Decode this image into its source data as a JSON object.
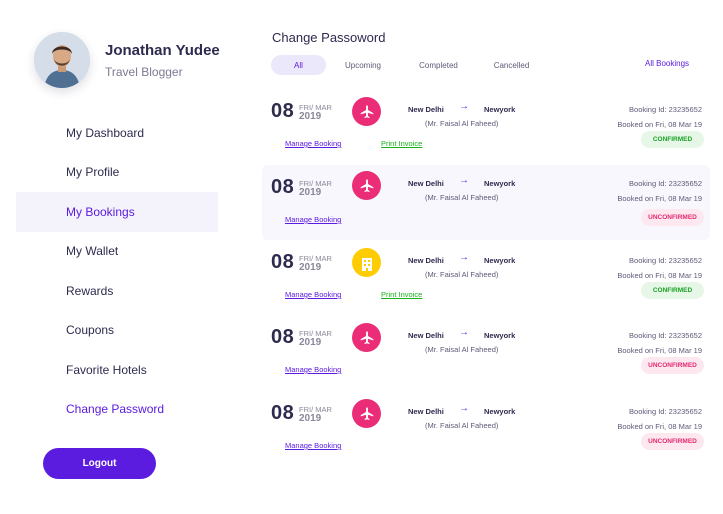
{
  "profile": {
    "name": "Jonathan Yudee",
    "role": "Travel Blogger"
  },
  "nav": [
    {
      "label": "My Dashboard",
      "active": false
    },
    {
      "label": "My Profile",
      "active": false
    },
    {
      "label": "My Bookings",
      "active": true
    },
    {
      "label": "My Wallet",
      "active": false
    },
    {
      "label": "Rewards",
      "active": false
    },
    {
      "label": "Coupons",
      "active": false
    },
    {
      "label": "Favorite Hotels",
      "active": false
    },
    {
      "label": "Change Password",
      "active": false,
      "accent": true
    }
  ],
  "logout_label": "Logout",
  "page_title": "Change Passoword",
  "tabs": [
    {
      "label": "All",
      "active": true
    },
    {
      "label": "Upcoming",
      "active": false
    },
    {
      "label": "Completed",
      "active": false
    },
    {
      "label": "Cancelled",
      "active": false
    }
  ],
  "all_bookings_label": "All Bookings",
  "colors": {
    "accent": "#5b1ce0",
    "flight_icon": "#ea2d76",
    "hotel_icon": "#ffcc02",
    "confirmed": "#1aa225",
    "unconfirmed": "#e4286f"
  },
  "bookings": [
    {
      "day": "08",
      "month": "FRI/ MAR",
      "year": "2019",
      "type_icon": "airplane-icon",
      "from": "New Delhi",
      "to": "Newyork",
      "passenger": "(Mr. Faisal Al Faheed)",
      "booking_id": "Booking Id: 23235652",
      "booked_on": "Booked on Fri, 08 Mar 19",
      "manage_label": "Manage Booking",
      "print_label": "Print Invoice",
      "status": "CONFIRMED",
      "status_type": "confirmed",
      "highlight": false
    },
    {
      "day": "08",
      "month": "FRI/ MAR",
      "year": "2019",
      "type_icon": "airplane-icon",
      "from": "New Delhi",
      "to": "Newyork",
      "passenger": "(Mr. Faisal Al Faheed)",
      "booking_id": "Booking Id: 23235652",
      "booked_on": "Booked on Fri, 08 Mar 19",
      "manage_label": "Manage Booking",
      "print_label": "",
      "status": "UNCONFIRMED",
      "status_type": "unconfirmed",
      "highlight": true
    },
    {
      "day": "08",
      "month": "FRI/ MAR",
      "year": "2019",
      "type_icon": "hotel-building-icon",
      "from": "New Delhi",
      "to": "Newyork",
      "passenger": "(Mr. Faisal Al Faheed)",
      "booking_id": "Booking Id: 23235652",
      "booked_on": "Booked on Fri, 08 Mar 19",
      "manage_label": "Manage Booking",
      "print_label": "Print Invoice",
      "status": "CONFIRMED",
      "status_type": "confirmed",
      "highlight": false
    },
    {
      "day": "08",
      "month": "FRI/ MAR",
      "year": "2019",
      "type_icon": "airplane-icon",
      "from": "New Delhi",
      "to": "Newyork",
      "passenger": "(Mr. Faisal Al Faheed)",
      "booking_id": "Booking Id: 23235652",
      "booked_on": "Booked on Fri, 08 Mar 19",
      "manage_label": "Manage Booking",
      "print_label": "",
      "status": "UNCONFIRMED",
      "status_type": "unconfirmed",
      "highlight": false
    },
    {
      "day": "08",
      "month": "FRI/ MAR",
      "year": "2019",
      "type_icon": "airplane-icon",
      "from": "New Delhi",
      "to": "Newyork",
      "passenger": "(Mr. Faisal Al Faheed)",
      "booking_id": "Booking Id: 23235652",
      "booked_on": "Booked on Fri, 08 Mar 19",
      "manage_label": "Manage Booking",
      "print_label": "",
      "status": "UNCONFIRMED",
      "status_type": "unconfirmed",
      "highlight": false
    }
  ]
}
